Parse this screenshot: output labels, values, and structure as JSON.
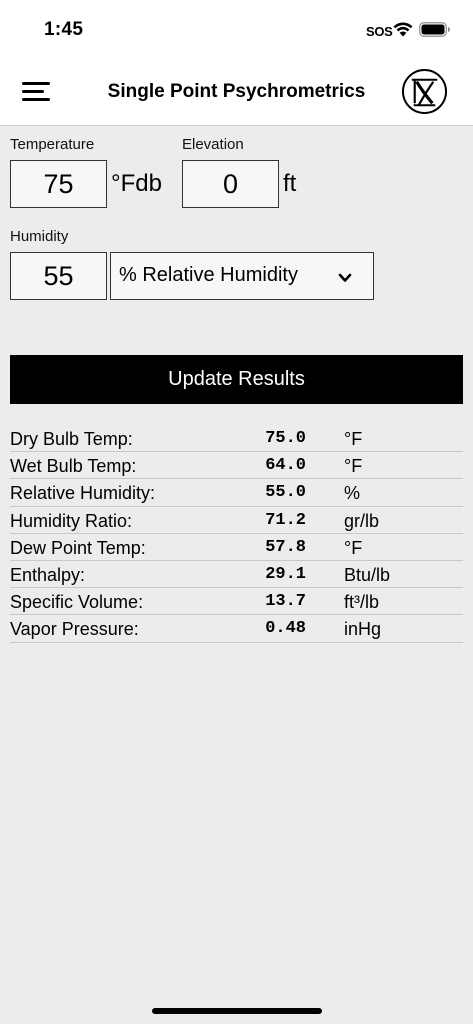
{
  "status_bar": {
    "time": "1:45",
    "sos": "SOS"
  },
  "nav": {
    "title": "Single Point Psychrometrics",
    "menu_icon": "hamburger-menu-icon",
    "logo_icon": "x-logo-icon"
  },
  "inputs": {
    "temperature": {
      "label": "Temperature",
      "value": "75",
      "unit": "°Fdb"
    },
    "elevation": {
      "label": "Elevation",
      "value": "0",
      "unit": "ft"
    },
    "humidity": {
      "label": "Humidity",
      "value": "55",
      "type_selected": "% Relative Humidity"
    }
  },
  "update_button": {
    "label": "Update Results"
  },
  "results": [
    {
      "label": "Dry Bulb Temp:",
      "value": "75.0",
      "unit": "°F"
    },
    {
      "label": "Wet Bulb Temp:",
      "value": "64.0",
      "unit": "°F"
    },
    {
      "label": "Relative Humidity:",
      "value": "55.0",
      "unit": "%"
    },
    {
      "label": "Humidity Ratio:",
      "value": "71.2",
      "unit": "gr/lb"
    },
    {
      "label": "Dew Point Temp:",
      "value": "57.8",
      "unit": "°F"
    },
    {
      "label": "Enthalpy:",
      "value": "29.1",
      "unit": "Btu/lb"
    },
    {
      "label": "Specific Volume:",
      "value": "13.7",
      "unit": "ft³/lb"
    },
    {
      "label": "Vapor Pressure:",
      "value": "0.48",
      "unit": "inHg"
    }
  ]
}
